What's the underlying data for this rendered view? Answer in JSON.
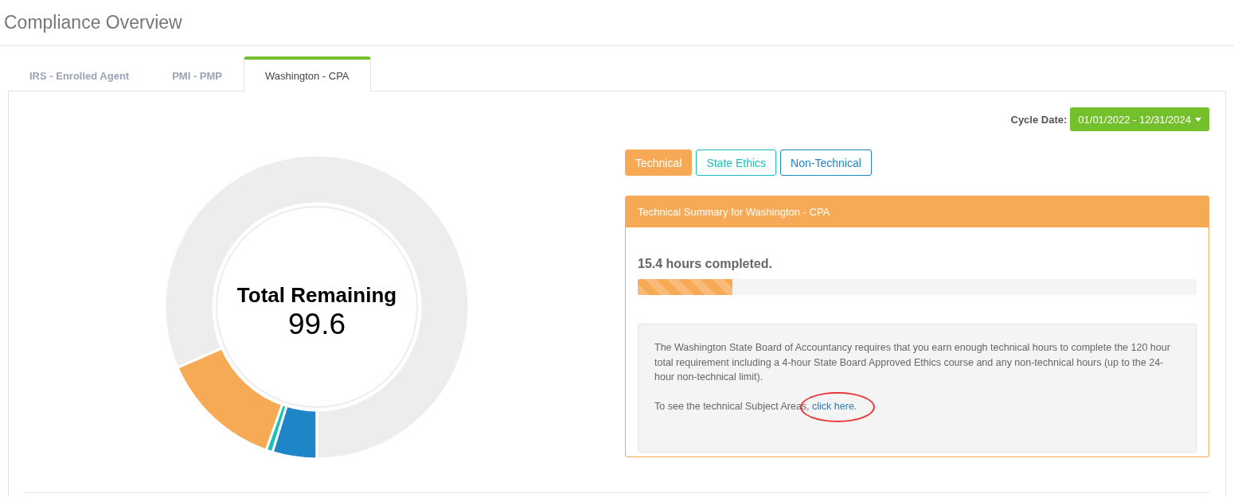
{
  "page_title": "Compliance Overview",
  "tabs": [
    {
      "label": "IRS - Enrolled Agent",
      "selected": false
    },
    {
      "label": "PMI - PMP",
      "selected": false
    },
    {
      "label": "Washington - CPA",
      "selected": true
    }
  ],
  "cycle_date": {
    "label": "Cycle Date:",
    "value": "01/01/2022 - 12/31/2024"
  },
  "donut": {
    "title": "Total Remaining",
    "value": "99.6"
  },
  "categories": [
    {
      "label": "Technical",
      "selected": true,
      "color": "#f7aa56"
    },
    {
      "label": "State Ethics",
      "selected": false,
      "color": "#1bbfc0"
    },
    {
      "label": "Non-Technical",
      "selected": false,
      "color": "#1e85c6"
    }
  ],
  "summary": {
    "title": "Technical Summary for Washington - CPA",
    "completed": "15.4 hours completed.",
    "level": 0.17,
    "description": "The Washington State Board of Accountancy requires that you earn enough technical hours to complete the 120 hour total requirement including a 4-hour State Board Approved Ethics course and any non-technical hours (up to the 24-hour non-technical limit).",
    "link_sentence": {
      "before": "To see the technical Subject Areas, ",
      "link": "click here",
      "after": "."
    }
  }
}
